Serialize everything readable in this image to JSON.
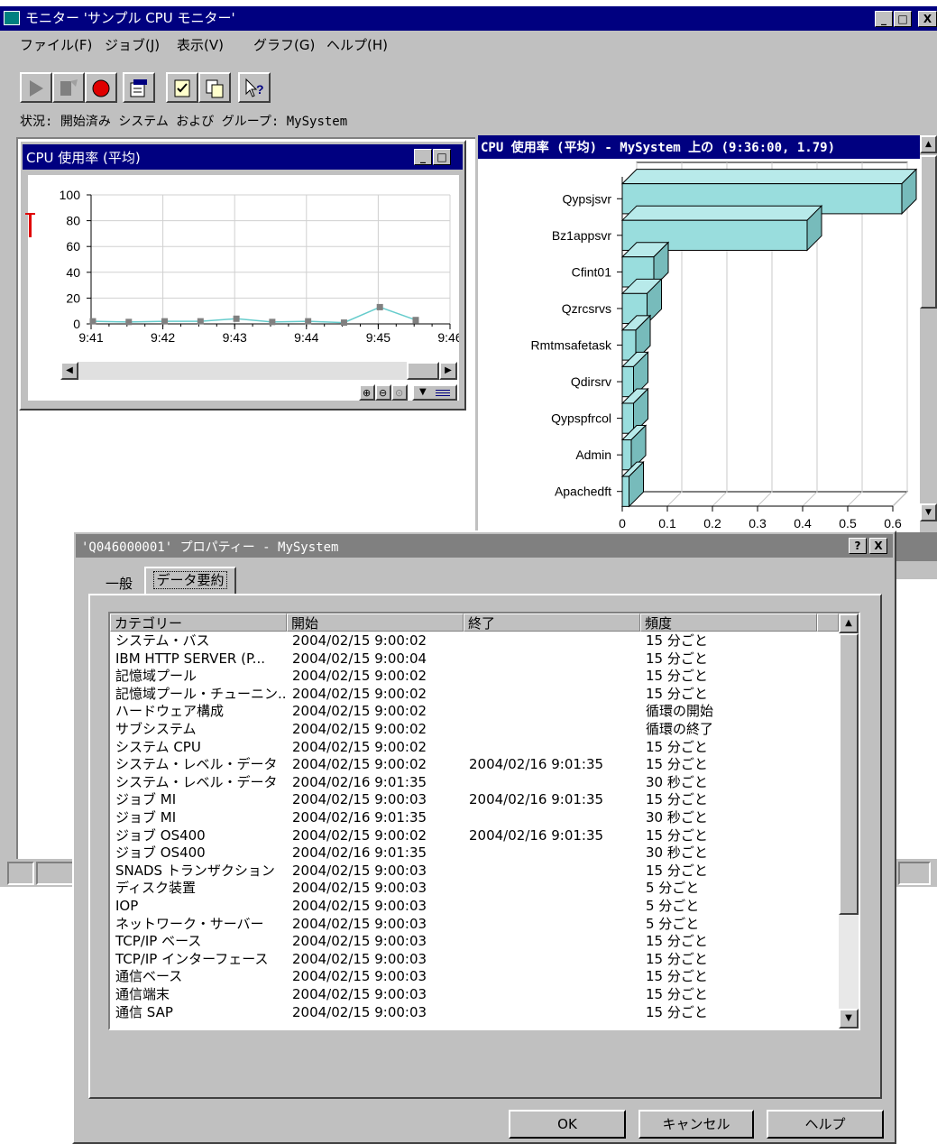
{
  "app": {
    "title": "モニター 'サンプル CPU モニター'",
    "controls": {
      "minimize": "_",
      "maximize": "□",
      "close": "X"
    }
  },
  "menu": {
    "items": [
      "ファイル(F)",
      "ジョブ(J)",
      "表示(V)",
      "グラフ(G)",
      "ヘルプ(H)"
    ]
  },
  "toolbar": {
    "icons": [
      "start-icon",
      "edit-icon",
      "record-icon",
      "properties-icon",
      "checklist-icon",
      "copy-icon",
      "whats-this-icon"
    ]
  },
  "status": {
    "text": "状況: 開始済み  システム および グループ:  MySystem"
  },
  "left_panel": {
    "title": "CPU 使用率 (平均)",
    "controls": {
      "minimize": "_",
      "maximize": "□"
    }
  },
  "right_panel": {
    "title": "CPU 使用率 (平均) - MySystem 上の (9:36:00, 1.79)"
  },
  "chart_data": [
    {
      "type": "line",
      "x": [
        "9:41",
        "9:41.5",
        "9:42",
        "9:42.5",
        "9:43",
        "9:43.5",
        "9:44",
        "9:44.5",
        "9:45",
        "9:45.5"
      ],
      "values": [
        2,
        1.5,
        2,
        2,
        4,
        1.5,
        2,
        1,
        13,
        3
      ],
      "xticks": [
        "9:41",
        "9:42",
        "9:43",
        "9:44",
        "9:45",
        "9:46"
      ],
      "yticks": [
        "100",
        "80",
        "60",
        "40",
        "20",
        "0"
      ],
      "ylim": [
        0,
        100
      ],
      "grid": true,
      "line_color": "#66cccc",
      "marker_color": "#808080"
    },
    {
      "type": "bar",
      "orientation": "horizontal",
      "categories": [
        "Qypsjsvr",
        "Bz1appsvr",
        "Cfint01",
        "Qzrcsrvs",
        "Rmtmsafetask",
        "Qdirsrv",
        "Qypspfrcol",
        "Admin",
        "Apachedft"
      ],
      "values": [
        0.62,
        0.41,
        0.07,
        0.055,
        0.03,
        0.025,
        0.025,
        0.02,
        0.015
      ],
      "xticks": [
        "0",
        "0.1",
        "0.2",
        "0.3",
        "0.4",
        "0.5",
        "0.6"
      ],
      "xlim": [
        0,
        0.6
      ],
      "grid": true,
      "bar_color": "#99dddd"
    }
  ],
  "dialog": {
    "title": "'Q046000001' プロパティー -  MySystem",
    "controls": {
      "help": "?",
      "close": "X"
    },
    "tabs": [
      "一般",
      "データ要約"
    ],
    "active_tab": "データ要約",
    "table": {
      "headers": [
        "カテゴリー",
        "開始",
        "終了",
        "頻度"
      ],
      "rows": [
        [
          "システム・バス",
          "2004/02/15 9:00:02",
          "",
          "15 分ごと"
        ],
        [
          "IBM HTTP SERVER (P...",
          "2004/02/15 9:00:04",
          "",
          "15 分ごと"
        ],
        [
          "記憶域プール",
          "2004/02/15 9:00:02",
          "",
          "15 分ごと"
        ],
        [
          "記憶域プール・チューニン...",
          "2004/02/15 9:00:02",
          "",
          "15 分ごと"
        ],
        [
          "ハードウェア構成",
          "2004/02/15 9:00:02",
          "",
          "循環の開始"
        ],
        [
          "サブシステム",
          "2004/02/15 9:00:02",
          "",
          "循環の終了"
        ],
        [
          "システム CPU",
          "2004/02/15 9:00:02",
          "",
          "15 分ごと"
        ],
        [
          "システム・レベル・データ",
          "2004/02/15 9:00:02",
          "2004/02/16 9:01:35",
          "15 分ごと"
        ],
        [
          "システム・レベル・データ",
          "2004/02/16 9:01:35",
          "",
          "30 秒ごと"
        ],
        [
          "ジョブ MI",
          "2004/02/15 9:00:03",
          "2004/02/16 9:01:35",
          "15 分ごと"
        ],
        [
          "ジョブ MI",
          "2004/02/16 9:01:35",
          "",
          "30 秒ごと"
        ],
        [
          "ジョブ OS400",
          "2004/02/15 9:00:02",
          "2004/02/16 9:01:35",
          "15 分ごと"
        ],
        [
          "ジョブ OS400",
          "2004/02/16 9:01:35",
          "",
          "30 秒ごと"
        ],
        [
          "SNADS トランザクション",
          "2004/02/15 9:00:03",
          "",
          "15 分ごと"
        ],
        [
          "ディスク装置",
          "2004/02/15 9:00:03",
          "",
          "5 分ごと"
        ],
        [
          "IOP",
          "2004/02/15 9:00:03",
          "",
          "5 分ごと"
        ],
        [
          "ネットワーク・サーバー",
          "2004/02/15 9:00:03",
          "",
          "5 分ごと"
        ],
        [
          "TCP/IP ベース",
          "2004/02/15 9:00:03",
          "",
          "15 分ごと"
        ],
        [
          "TCP/IP インターフェース",
          "2004/02/15 9:00:03",
          "",
          "15 分ごと"
        ],
        [
          "通信ベース",
          "2004/02/15 9:00:03",
          "",
          "15 分ごと"
        ],
        [
          "通信端末",
          "2004/02/15 9:00:03",
          "",
          "15 分ごと"
        ],
        [
          "通信 SAP",
          "2004/02/15 9:00:03",
          "",
          "15 分ごと"
        ]
      ]
    },
    "buttons": {
      "ok": "OK",
      "cancel": "キャンセル",
      "help": "ヘルプ"
    }
  }
}
